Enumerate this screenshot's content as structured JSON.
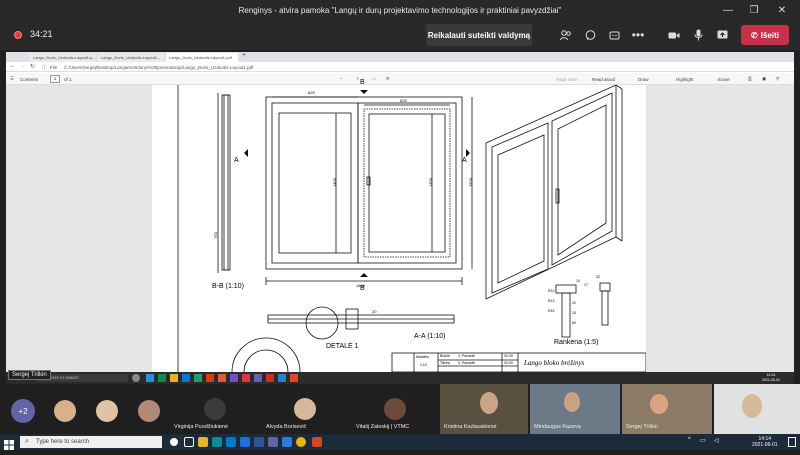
{
  "window": {
    "title": "Renginys - atvira pamoka \"Langų ir durų projektavimo technologijos ir praktiniai pavyzdžiai\""
  },
  "meeting": {
    "timer": "34:21",
    "take_control_label": "Reikalauti suteikti valdymą",
    "leave_label": "Išeiti"
  },
  "browser": {
    "tabs": [
      {
        "label": "Langu_Duris_Uzduotis-Layout1.p..."
      },
      {
        "label": "Langu_Duris_Uzduotis-Layout1..."
      },
      {
        "label": "Langu_Duris_Uzduotis-Layout1.pdf"
      }
    ],
    "url_label": "File",
    "url": "C:/Users/Sergej/Desktop/Langai%20durys%20prezentacija/Langu_Duris_Uzduotis-Layout1.pdf"
  },
  "pdf_toolbar": {
    "contents": "Contents",
    "page_current": "1",
    "page_total": "of 1",
    "page_view": "Page view",
    "read_aloud": "Read aloud",
    "draw": "Draw",
    "highlight": "Highlight",
    "erase": "Erase"
  },
  "drawing": {
    "section_bb": "B-B (1:10)",
    "section_aa": "A-A (1:10)",
    "detail_label": "DETALĖ 1",
    "handle_label": "Rankena (1:5)",
    "marker_a": "A",
    "marker_b": "B",
    "dim_left_width": "625",
    "dim_right_width": "625",
    "dim_left_height": "1400",
    "dim_right_height": "1300",
    "dim_total_height": "1500",
    "dim_total_width": "1600",
    "dim_750": "750",
    "dim_20": "20",
    "handle_dims": [
      "10",
      "17",
      "22",
      "24",
      "32",
      "60",
      "R10",
      "R13",
      "R15"
    ],
    "title_block": {
      "row1_label": "Masteliu",
      "row1_value": "1:10",
      "row2_a": "Braižė",
      "row2_b": "V. Pavardė",
      "row3_a": "Tikrino",
      "row3_b": "V. Pavardė",
      "date": "00-00",
      "title": "Lango bloko brėžinys"
    }
  },
  "shared_taskbar": {
    "search_placeholder": "Type here to search",
    "time": "14:14",
    "date": "2021-06-01"
  },
  "participants": {
    "overflow_count": "+2",
    "tiles": [
      {
        "name": "Virginija Puodžiukienė"
      },
      {
        "name": "Alvyda Borisevič"
      },
      {
        "name": "Vitalij Zaleskij | VTMC"
      },
      {
        "name": "Kristina Kazlauskienė"
      },
      {
        "name": "Mindaugas Kazeva"
      },
      {
        "name": "Sergej Trilkin"
      }
    ],
    "presenter_name": "Sergej Trilkin"
  },
  "taskbar": {
    "search_placeholder": "Type here to search",
    "time": "14:14",
    "date": "2021-06-01"
  },
  "icons": {
    "record": "record-icon",
    "participants": "people-icon",
    "chat": "chat-icon",
    "more": "more-icon",
    "camera": "camera-icon",
    "mic": "mic-icon",
    "share": "share-icon",
    "phone": "phone-icon"
  }
}
